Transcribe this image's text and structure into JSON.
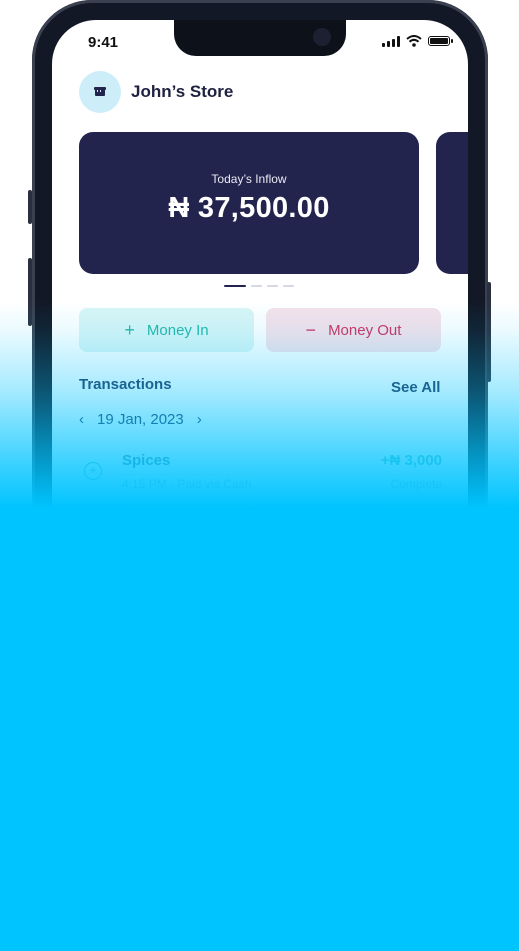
{
  "status_bar": {
    "time": "9:41"
  },
  "store": {
    "name": "John’s Store",
    "icon": "store-icon"
  },
  "inflow_card": {
    "label": "Today’s Inflow",
    "amount": "₦ 37,500.00"
  },
  "pager": {
    "pages": 4,
    "active": 0
  },
  "actions": {
    "money_in": {
      "symbol": "+",
      "label": "Money In"
    },
    "money_out": {
      "symbol": "−",
      "label": "Money Out"
    }
  },
  "transactions": {
    "title": "Transactions",
    "see_all": "See All",
    "date": "19 Jan, 2023",
    "prev_icon": "chevron-left-icon",
    "next_icon": "chevron-right-icon",
    "items": [
      {
        "name": "Spices",
        "meta": "4:15 PM  ·  Paid via Cash",
        "amount": "+₦ 3,000",
        "status": "Complete"
      }
    ]
  },
  "colors": {
    "card_bg": "#22244e",
    "money_in": "#25b6a8",
    "money_out": "#cf2f5d",
    "overlay": "#00c4ff"
  }
}
